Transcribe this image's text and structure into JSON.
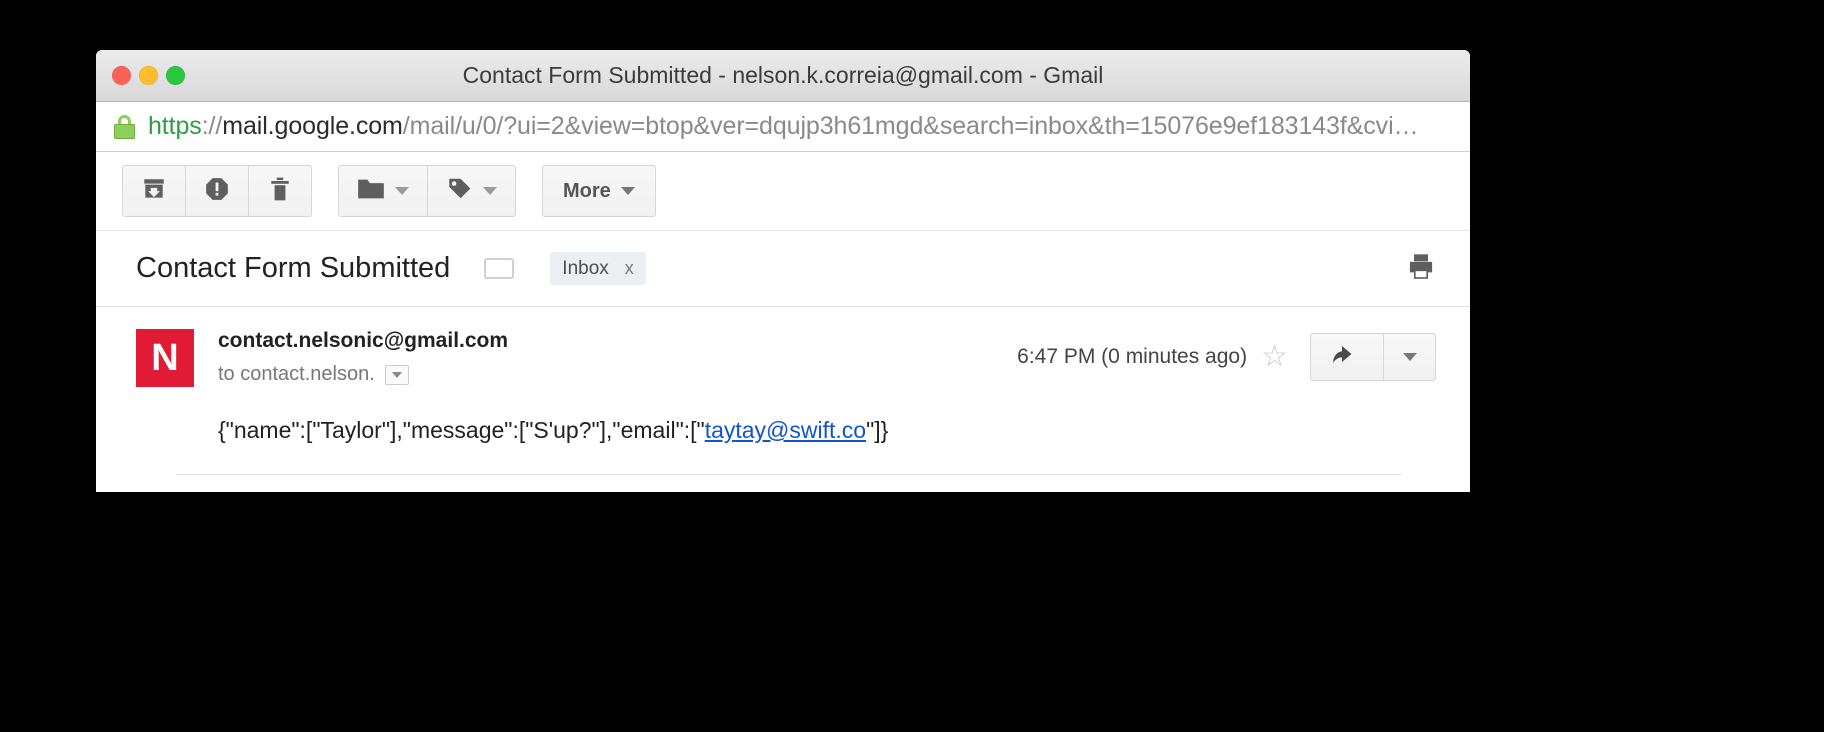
{
  "window": {
    "title": "Contact Form Submitted - nelson.k.correia@gmail.com - Gmail",
    "traffic_lights": [
      "close",
      "minimize",
      "zoom"
    ]
  },
  "urlbar": {
    "lock_icon": "lock-icon",
    "scheme": "https",
    "separator": "://",
    "host": "mail.google.com",
    "path": "/mail/u/0/?ui=2&view=btop&ver=dqujp3h61mgd&search=inbox&th=15076e9ef183143f&cvi…",
    "full_url": "https://mail.google.com/mail/u/0/?ui=2&view=btop&ver=dqujp3h61mgd&search=inbox&th=15076e9ef183143f&cvi…",
    "scheme_color": "#2e9e45",
    "host_color": "#2b2b2b",
    "path_color": "#8a8a8a"
  },
  "toolbar": {
    "buttons": [
      {
        "name": "archive",
        "icon": "archive-icon",
        "label": ""
      },
      {
        "name": "report-spam",
        "icon": "spam-icon",
        "label": ""
      },
      {
        "name": "delete",
        "icon": "trash-icon",
        "label": ""
      },
      {
        "name": "move-to",
        "icon": "folder-icon",
        "label": "",
        "has_caret": true
      },
      {
        "name": "labels",
        "icon": "tag-icon",
        "label": "",
        "has_caret": true
      }
    ],
    "more_label": "More",
    "more_has_caret": true
  },
  "thread": {
    "subject": "Contact Form Submitted",
    "label_toggle_icon": "label-outline-icon",
    "chip_label": "Inbox",
    "chip_remove": "x",
    "print_icon": "printer-icon"
  },
  "message": {
    "avatar_letter": "N",
    "avatar_color": "#e11b35",
    "from": "contact.nelsonic@gmail.com",
    "to": "to contact.nelson.",
    "to_caret_icon": "chevron-down-icon",
    "timestamp": "6:47 PM (0 minutes ago)",
    "star_icon": "☆",
    "reply_icon": "reply-arrow-icon",
    "more_icon": "chevron-down-icon",
    "body": {
      "before_link": "{\"name\":[\"Taylor\"],\"message\":[\"S'up?\"],\"email\":[\"",
      "link_text": "taytay@swift.co",
      "after_link": "\"]}",
      "link_color": "#1155cc",
      "full_text": "{\"name\":[\"Taylor\"],\"message\":[\"S'up?\"],\"email\":[\"taytay@swift.co\"]}"
    }
  }
}
